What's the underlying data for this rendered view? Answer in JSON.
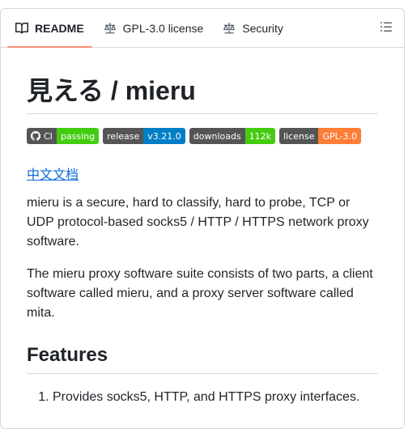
{
  "tabs": [
    {
      "label": "README",
      "icon": "book-icon",
      "active": true
    },
    {
      "label": "GPL-3.0 license",
      "icon": "scale-icon"
    },
    {
      "label": "Security",
      "icon": "scale-icon"
    }
  ],
  "toc_icon": "list-icon",
  "readme": {
    "title": "見える / mieru",
    "badges": [
      {
        "left": "CI",
        "right": "passing",
        "color": "#4c1",
        "icon": "github-icon"
      },
      {
        "left": "release",
        "right": "v3.21.0",
        "color": "#007ec6"
      },
      {
        "left": "downloads",
        "right": "112k",
        "color": "#4c1"
      },
      {
        "left": "license",
        "right": "GPL-3.0",
        "color": "#fe7d37"
      }
    ],
    "chinese_doc_link": "中文文档",
    "paragraphs": [
      "mieru is a secure, hard to classify, hard to probe, TCP or UDP protocol-based socks5 / HTTP / HTTPS network proxy software.",
      "The mieru proxy software suite consists of two parts, a client software called mieru, and a proxy server software called mita."
    ],
    "features_heading": "Features",
    "features": [
      "Provides socks5, HTTP, and HTTPS proxy interfaces."
    ]
  }
}
